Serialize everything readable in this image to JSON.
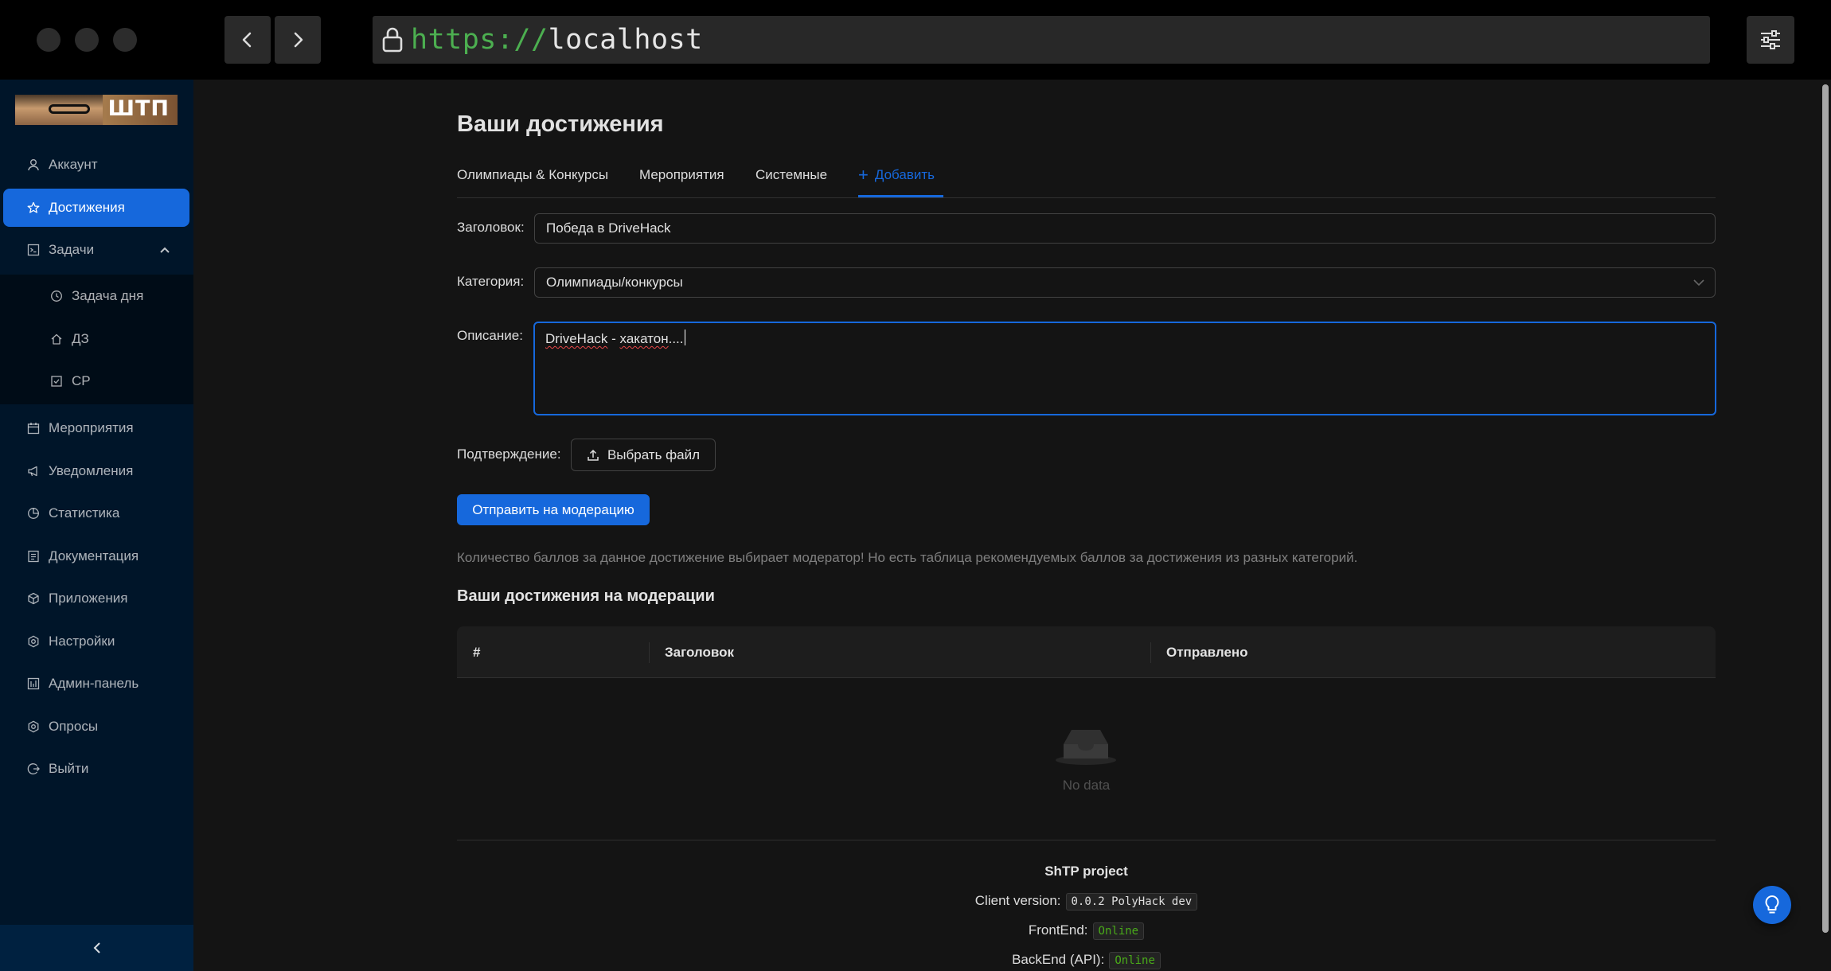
{
  "browser": {
    "url_protocol": "https://",
    "url_host": "localhost"
  },
  "sidebar": {
    "logo_text": "ШТП",
    "items": [
      {
        "label": "Аккаунт",
        "icon": "user-icon"
      },
      {
        "label": "Достижения",
        "icon": "star-icon",
        "active": true
      },
      {
        "label": "Задачи",
        "icon": "code-icon",
        "expanded": true
      },
      {
        "label": "Мероприятия",
        "icon": "calendar-icon"
      },
      {
        "label": "Уведомления",
        "icon": "megaphone-icon"
      },
      {
        "label": "Статистика",
        "icon": "pie-chart-icon"
      },
      {
        "label": "Документация",
        "icon": "document-icon"
      },
      {
        "label": "Приложения",
        "icon": "apps-icon"
      },
      {
        "label": "Настройки",
        "icon": "gear-icon"
      },
      {
        "label": "Админ-панель",
        "icon": "dashboard-icon"
      },
      {
        "label": "Опросы",
        "icon": "poll-gear-icon"
      },
      {
        "label": "Выйти",
        "icon": "logout-icon"
      }
    ],
    "sub_items": [
      {
        "label": "Задача дня",
        "icon": "clock-icon"
      },
      {
        "label": "ДЗ",
        "icon": "home-icon"
      },
      {
        "label": "СР",
        "icon": "checkbox-icon"
      }
    ]
  },
  "main": {
    "title": "Ваши достижения",
    "tabs": [
      {
        "label": "Олимпиады & Конкурсы"
      },
      {
        "label": "Мероприятия"
      },
      {
        "label": "Системные"
      },
      {
        "label": "Добавить",
        "active": true
      }
    ],
    "form": {
      "title_label": "Заголовок",
      "title_value": "Победа в DriveHack",
      "category_label": "Категория",
      "category_value": "Олимпиады/конкурсы",
      "description_label": "Описание",
      "description_word1": "DriveHack",
      "description_sep": " - ",
      "description_word2": "хакатон",
      "description_tail": "....",
      "confirmation_label": "Подтверждение",
      "upload_label": "Выбрать файл",
      "submit_label": "Отправить на модерацию"
    },
    "hint": "Количество баллов за данное достижение выбирает модератор! Но есть таблица рекомендуемых баллов за достижения из разных категорий.",
    "moderation_title": "Ваши достижения на модерации",
    "table": {
      "columns": [
        "#",
        "Заголовок",
        "Отправлено"
      ],
      "rows": [],
      "empty_text": "No data"
    },
    "footer": {
      "project": "ShTP project",
      "client_label": "Client version:",
      "client_version": "0.0.2 PolyHack dev",
      "frontend_label": "FrontEnd:",
      "frontend_status": "Online",
      "backend_label": "BackEnd (API):",
      "backend_status": "Online"
    }
  },
  "colors": {
    "accent": "#1668dc",
    "sidebar_bg": "#001529",
    "main_bg": "#141414",
    "status_ok": "#49aa19"
  }
}
